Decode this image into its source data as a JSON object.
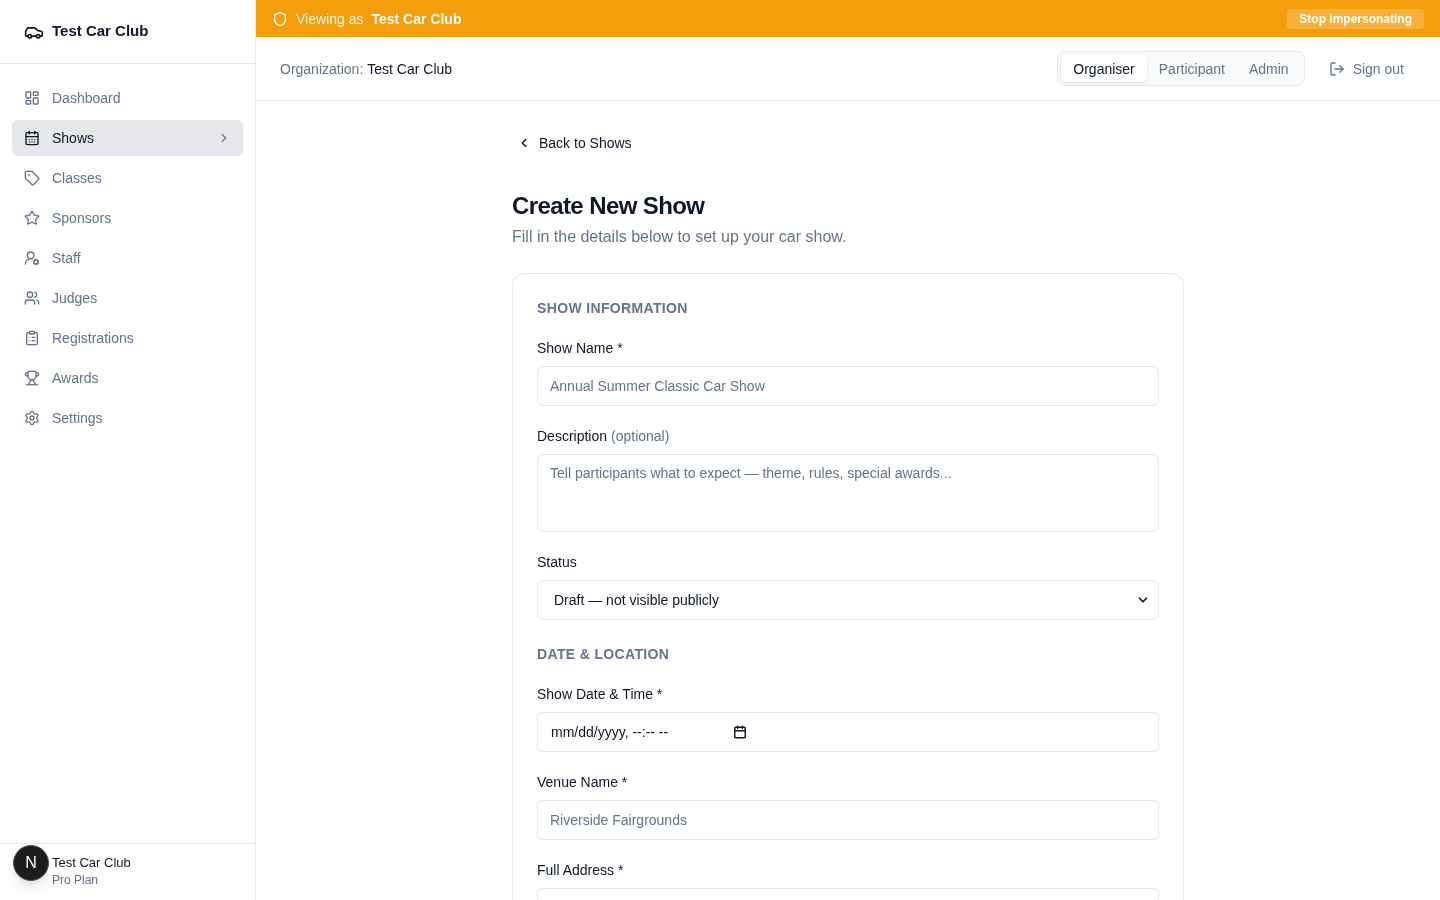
{
  "banner": {
    "prefix": "Viewing as",
    "organization": "Test Car Club",
    "button": "Stop impersonating"
  },
  "sidebar": {
    "brand": "Test Car Club",
    "items": [
      {
        "label": "Dashboard",
        "selected": false
      },
      {
        "label": "Shows",
        "selected": true
      },
      {
        "label": "Classes",
        "selected": false
      },
      {
        "label": "Sponsors",
        "selected": false
      },
      {
        "label": "Staff",
        "selected": false
      },
      {
        "label": "Judges",
        "selected": false
      },
      {
        "label": "Registrations",
        "selected": false
      },
      {
        "label": "Awards",
        "selected": false
      },
      {
        "label": "Settings",
        "selected": false
      }
    ],
    "footer": {
      "name": "Test Car Club",
      "plan": "Pro Plan"
    }
  },
  "dev_badge": {
    "label": "N"
  },
  "header": {
    "organization_label": "Organization:",
    "organization": "Test Car Club",
    "roles": [
      {
        "label": "Organiser",
        "selected": true
      },
      {
        "label": "Participant",
        "selected": false
      },
      {
        "label": "Admin",
        "selected": false
      }
    ],
    "sign_out": "Sign out"
  },
  "page": {
    "back_link": "Back to Shows",
    "title": "Create New Show",
    "subtitle": "Fill in the details below to set up your car show.",
    "sections": [
      {
        "heading": "SHOW INFORMATION",
        "fields": [
          {
            "kind": "text",
            "label": "Show Name *",
            "placeholder": "Annual Summer Classic Car Show"
          },
          {
            "kind": "textarea",
            "label": "Description",
            "hint": "(optional)",
            "placeholder": "Tell participants what to expect — theme, rules, special awards..."
          },
          {
            "kind": "select",
            "label": "Status",
            "value": "Draft — not visible publicly"
          }
        ]
      },
      {
        "heading": "DATE & LOCATION",
        "fields": [
          {
            "kind": "datetime",
            "label": "Show Date & Time *",
            "value": "mm/dd/yyyy, --:-- --"
          },
          {
            "kind": "text",
            "label": "Venue Name *",
            "placeholder": "Riverside Fairgrounds"
          },
          {
            "kind": "text",
            "label": "Full Address *"
          }
        ]
      }
    ]
  }
}
